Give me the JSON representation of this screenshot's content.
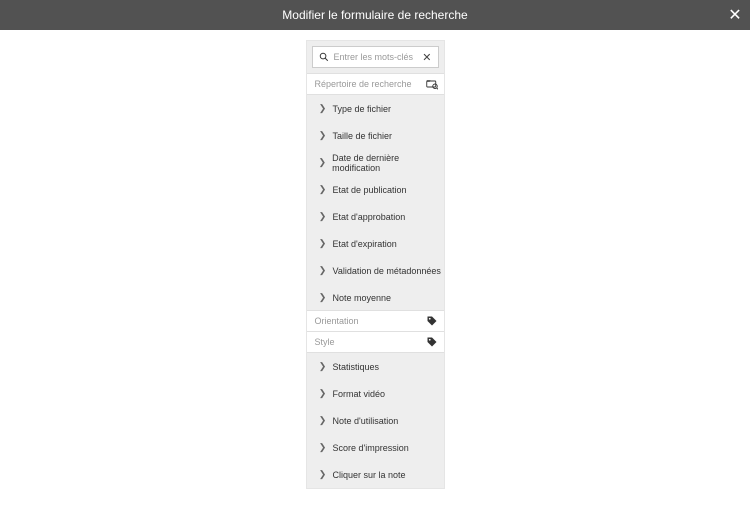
{
  "header": {
    "title": "Modifier le formulaire de recherche",
    "close": "✕"
  },
  "search": {
    "placeholder": "Entrer les mots-clés"
  },
  "repo": {
    "label": "Répertoire de recherche"
  },
  "facets_top": [
    "Type de fichier",
    "Taille de fichier",
    "Date de dernière modification",
    "Etat de publication",
    "Etat d'approbation",
    "Etat d'expiration",
    "Validation de métadonnées",
    "Note moyenne"
  ],
  "fields": [
    "Orientation",
    "Style"
  ],
  "facets_bottom": [
    "Statistiques",
    "Format vidéo",
    "Note d'utilisation",
    "Score d'impression",
    "Cliquer sur la note"
  ]
}
